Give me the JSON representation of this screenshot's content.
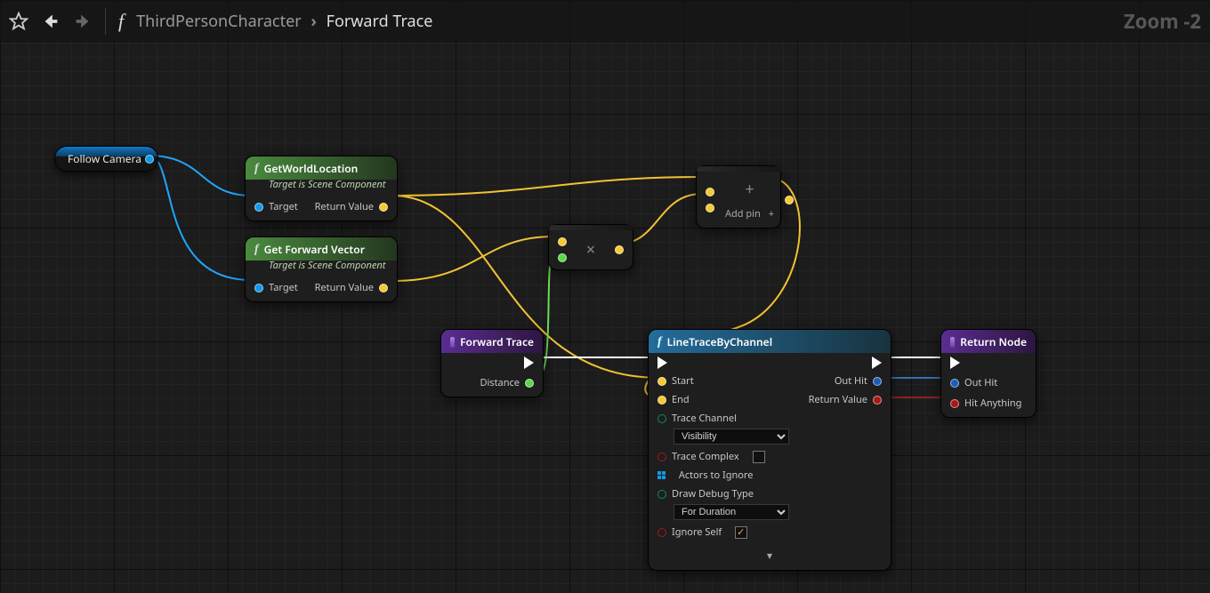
{
  "toolbar": {
    "breadcrumb_parent": "ThirdPersonCharacter",
    "breadcrumb_current": "Forward Trace",
    "zoom_label": "Zoom -2"
  },
  "nodes": {
    "follow_camera": {
      "label": "Follow Camera"
    },
    "get_world_location": {
      "title": "GetWorldLocation",
      "subtitle": "Target is Scene Component",
      "target": "Target",
      "return": "Return Value"
    },
    "get_forward_vector": {
      "title": "Get Forward Vector",
      "subtitle": "Target is Scene Component",
      "target": "Target",
      "return": "Return Value"
    },
    "multiply": {
      "glyph": "×"
    },
    "add": {
      "glyph": "+",
      "add_pin": "Add pin"
    },
    "forward_trace": {
      "title": "Forward Trace",
      "distance": "Distance"
    },
    "line_trace": {
      "title": "LineTraceByChannel",
      "start": "Start",
      "end": "End",
      "out_hit": "Out Hit",
      "return": "Return Value",
      "trace_channel_label": "Trace Channel",
      "trace_channel_value": "Visibility",
      "trace_complex": "Trace Complex",
      "actors_to_ignore": "Actors to Ignore",
      "draw_debug_label": "Draw Debug Type",
      "draw_debug_value": "For Duration",
      "ignore_self": "Ignore Self"
    },
    "return_node": {
      "title": "Return Node",
      "out_hit": "Out Hit",
      "hit_anything": "Hit Anything"
    }
  }
}
